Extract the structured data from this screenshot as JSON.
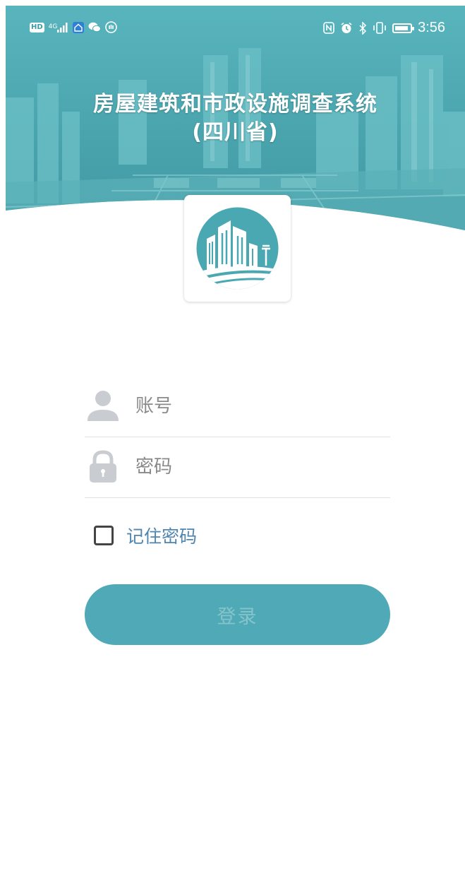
{
  "status_bar": {
    "network_badge": "HD",
    "signal_text": "4G",
    "time": "3:56",
    "battery_level": 0.9,
    "left_icons": [
      "hd-icon",
      "signal-icon",
      "home-app-icon",
      "wechat-icon",
      "hand-icon"
    ],
    "right_icons": [
      "nfc-icon",
      "alarm-icon",
      "bluetooth-icon",
      "vibrate-icon",
      "battery-icon"
    ]
  },
  "header": {
    "title_line1": "房屋建筑和市政设施调查系统",
    "title_line2": "(四川省)",
    "banner_color": "#4aa8b2",
    "logo_color": "#4aa8b2"
  },
  "form": {
    "username_placeholder": "账号",
    "password_placeholder": "密码",
    "remember_label": "记住密码",
    "remember_checked": false,
    "login_label": "登录",
    "accent_color": "#4fa9b6",
    "link_color": "#4f86b0"
  }
}
